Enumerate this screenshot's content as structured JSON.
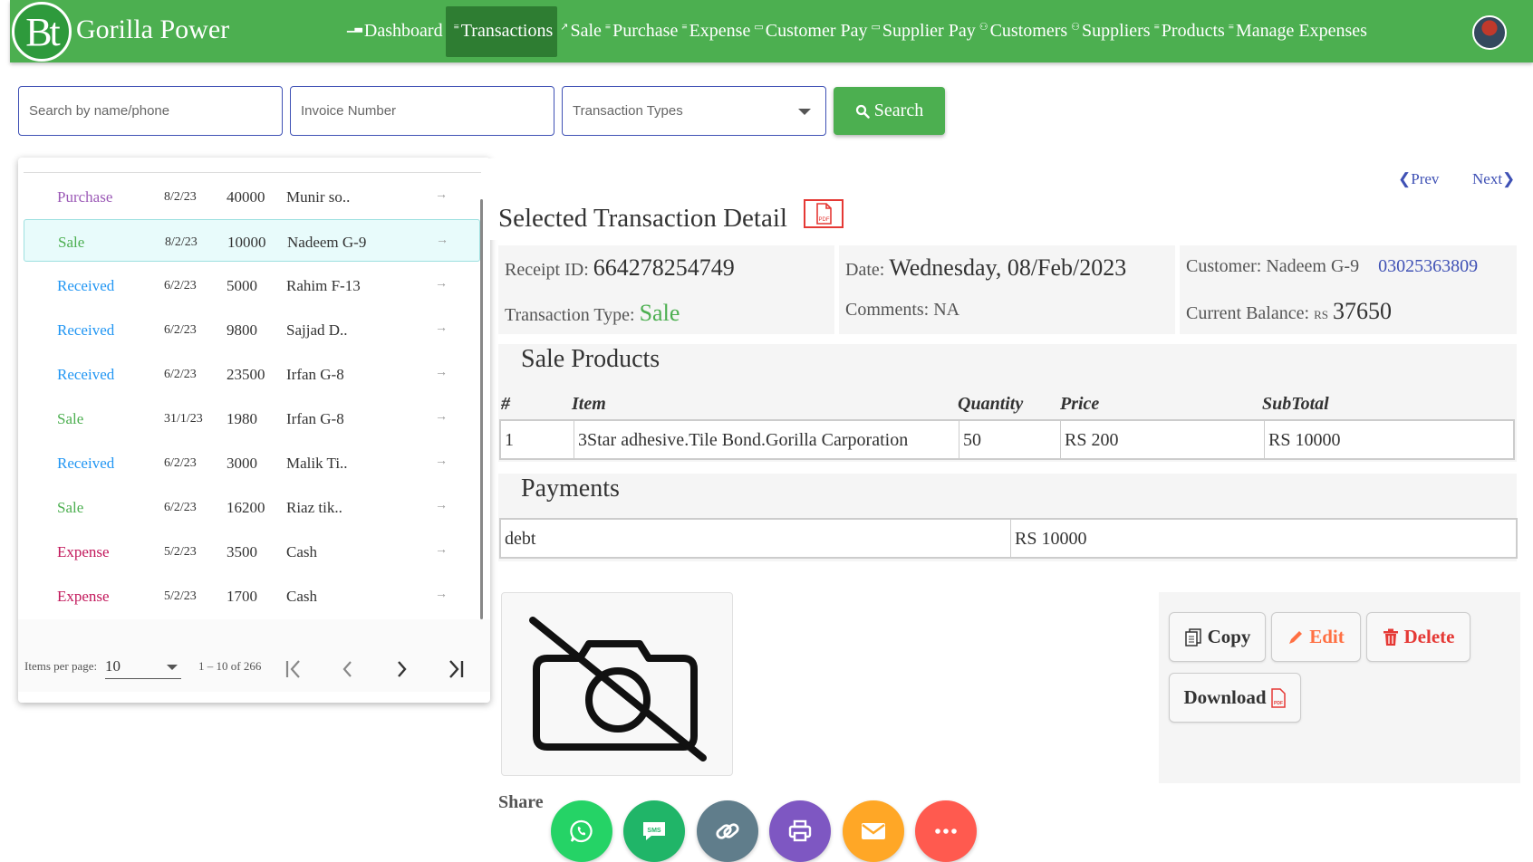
{
  "app": {
    "logo_text": "Bt",
    "brand": "Gorilla Power"
  },
  "nav": [
    {
      "label": "Dashboard",
      "icon": "chart-icon"
    },
    {
      "label": "Transactions",
      "icon": "list-icon",
      "active": true
    },
    {
      "label": "Sale",
      "icon": "trend-icon"
    },
    {
      "label": "Purchase",
      "icon": "list-icon"
    },
    {
      "label": "Expense",
      "icon": "list-icon"
    },
    {
      "label": "Customer Pay",
      "icon": "card-icon"
    },
    {
      "label": "Supplier Pay",
      "icon": "card-icon"
    },
    {
      "label": "Customers",
      "icon": "people-icon"
    },
    {
      "label": "Suppliers",
      "icon": "people-icon"
    },
    {
      "label": "Products",
      "icon": "list-icon"
    },
    {
      "label": "Manage Expenses",
      "icon": "list-icon"
    }
  ],
  "filters": {
    "search_placeholder": "Search by name/phone",
    "invoice_placeholder": "Invoice Number",
    "type_placeholder": "Transaction Types",
    "search_label": "Search"
  },
  "transactions": [
    {
      "type": "Purchase",
      "date": "8/2/23",
      "amount": "40000",
      "name": "Munir so..",
      "color": "#9b59b6"
    },
    {
      "type": "Sale",
      "date": "8/2/23",
      "amount": "10000",
      "name": "Nadeem G-9",
      "color": "#4caf50",
      "selected": true
    },
    {
      "type": "Received",
      "date": "6/2/23",
      "amount": "5000",
      "name": "Rahim F-13",
      "color": "#2196f3"
    },
    {
      "type": "Received",
      "date": "6/2/23",
      "amount": "9800",
      "name": "Sajjad D..",
      "color": "#2196f3"
    },
    {
      "type": "Received",
      "date": "6/2/23",
      "amount": "23500",
      "name": "Irfan G-8",
      "color": "#2196f3"
    },
    {
      "type": "Sale",
      "date": "31/1/23",
      "amount": "1980",
      "name": "Irfan G-8",
      "color": "#4caf50"
    },
    {
      "type": "Received",
      "date": "6/2/23",
      "amount": "3000",
      "name": "Malik Ti..",
      "color": "#2196f3"
    },
    {
      "type": "Sale",
      "date": "6/2/23",
      "amount": "16200",
      "name": "Riaz tik..",
      "color": "#4caf50"
    },
    {
      "type": "Expense",
      "date": "5/2/23",
      "amount": "3500",
      "name": "Cash",
      "color": "#c2185b"
    },
    {
      "type": "Expense",
      "date": "5/2/23",
      "amount": "1700",
      "name": "Cash",
      "color": "#c2185b"
    }
  ],
  "paginator": {
    "label": "Items per page:",
    "per_page": "10",
    "range": "1 – 10 of 266"
  },
  "detail": {
    "prev": "❮Prev",
    "next": "Next❯",
    "title": "Selected Transaction Detail",
    "pdf": "PDF",
    "receipt_label": "Receipt ID:",
    "receipt_id": "664278254749",
    "date_label": "Date:",
    "date": "Wednesday, 08/Feb/2023",
    "customer_label": "Customer:",
    "customer": "Nadeem G-9",
    "phone": "03025363809",
    "type_label": "Transaction Type:",
    "type": "Sale",
    "comments_label": "Comments:",
    "comments": "NA",
    "balance_label": "Current Balance:",
    "balance_currency": "RS",
    "balance": "37650"
  },
  "products": {
    "title": "Sale Products",
    "headers": [
      "#",
      "Item",
      "Quantity",
      "Price",
      "SubTotal"
    ],
    "rows": [
      {
        "num": "1",
        "item": "3Star adhesive.Tile Bond.Gorilla Carporation",
        "qty": "50",
        "price": "RS 200",
        "subtotal": "RS 10000"
      }
    ]
  },
  "payments": {
    "title": "Payments",
    "rows": [
      {
        "method": "debt",
        "amount": "RS 10000"
      }
    ]
  },
  "actions": {
    "copy": "Copy",
    "edit": "Edit",
    "delete": "Delete",
    "download": "Download"
  },
  "share": {
    "label": "Share",
    "buttons": [
      {
        "name": "whatsapp",
        "color": "#25d366"
      },
      {
        "name": "sms",
        "color": "#20b568"
      },
      {
        "name": "link",
        "color": "#607d8b"
      },
      {
        "name": "print",
        "color": "#7e57c2"
      },
      {
        "name": "email",
        "color": "#ffa726"
      },
      {
        "name": "more",
        "color": "#ff5a4f"
      }
    ]
  },
  "colors": {
    "primary": "#4caf50",
    "primary_dark": "#2e7d32",
    "accent": "#3f51b5",
    "danger": "#e53935"
  }
}
